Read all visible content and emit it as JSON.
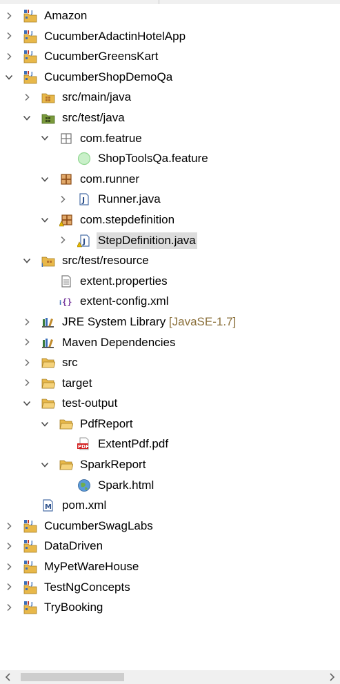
{
  "tree": [
    {
      "label": "Amazon",
      "icon": "maven-project-icon",
      "expanded": false,
      "level": 0
    },
    {
      "label": "CucumberAdactinHotelApp",
      "icon": "maven-project-icon",
      "expanded": false,
      "level": 0
    },
    {
      "label": "CucumberGreensKart",
      "icon": "maven-project-icon",
      "expanded": false,
      "level": 0
    },
    {
      "label": "CucumberShopDemoQa",
      "icon": "maven-project-icon",
      "expanded": true,
      "level": 0
    },
    {
      "label": "src/main/java",
      "icon": "source-folder-icon",
      "expanded": false,
      "level": 1
    },
    {
      "label": "src/test/java",
      "icon": "test-source-folder-icon",
      "expanded": true,
      "level": 1
    },
    {
      "label": "com.featrue",
      "icon": "empty-package-icon",
      "expanded": true,
      "level": 2
    },
    {
      "label": "ShopToolsQa.feature",
      "icon": "cucumber-feature-icon",
      "level": 3
    },
    {
      "label": "com.runner",
      "icon": "package-icon",
      "expanded": true,
      "level": 2
    },
    {
      "label": "Runner.java",
      "icon": "java-file-icon",
      "expanded": false,
      "level": 3
    },
    {
      "label": "com.stepdefinition",
      "icon": "package-warning-icon",
      "expanded": true,
      "level": 2
    },
    {
      "label": "StepDefinition.java",
      "icon": "java-file-warning-icon",
      "expanded": false,
      "level": 3,
      "selected": true
    },
    {
      "label": "src/test/resource",
      "icon": "resource-folder-icon",
      "expanded": true,
      "level": 1
    },
    {
      "label": "extent.properties",
      "icon": "properties-file-icon",
      "level": 2
    },
    {
      "label": "extent-config.xml",
      "icon": "xml-file-icon",
      "level": 2
    },
    {
      "label": "JRE System Library",
      "decoration": "[JavaSE-1.7]",
      "icon": "library-icon",
      "expanded": false,
      "level": 1
    },
    {
      "label": "Maven Dependencies",
      "icon": "library-icon",
      "expanded": false,
      "level": 1
    },
    {
      "label": "src",
      "icon": "folder-icon",
      "expanded": false,
      "level": 1
    },
    {
      "label": "target",
      "icon": "folder-icon",
      "expanded": false,
      "level": 1
    },
    {
      "label": "test-output",
      "icon": "folder-icon",
      "expanded": true,
      "level": 1
    },
    {
      "label": "PdfReport",
      "icon": "folder-icon",
      "expanded": true,
      "level": 2
    },
    {
      "label": "ExtentPdf.pdf",
      "icon": "pdf-file-icon",
      "level": 3
    },
    {
      "label": "SparkReport",
      "icon": "folder-icon",
      "expanded": true,
      "level": 2
    },
    {
      "label": "Spark.html",
      "icon": "html-file-icon",
      "level": 3
    },
    {
      "label": "pom.xml",
      "icon": "maven-pom-icon",
      "level": 1
    },
    {
      "label": "CucumberSwagLabs",
      "icon": "maven-project-icon",
      "expanded": false,
      "level": 0
    },
    {
      "label": "DataDriven",
      "icon": "maven-project-icon",
      "expanded": false,
      "level": 0
    },
    {
      "label": "MyPetWareHouse",
      "icon": "maven-project-icon",
      "expanded": false,
      "level": 0
    },
    {
      "label": "TestNgConcepts",
      "icon": "maven-project-icon",
      "expanded": false,
      "level": 0
    },
    {
      "label": "TryBooking",
      "icon": "maven-project-icon",
      "expanded": false,
      "level": 0
    }
  ],
  "colors": {
    "selection": "#dcdcdc",
    "decoration": "#8a6f3a",
    "folder": "#e8b84a",
    "package": "#b5722c",
    "maven_blue": "#3c6fb8",
    "warning": "#e6b800"
  }
}
